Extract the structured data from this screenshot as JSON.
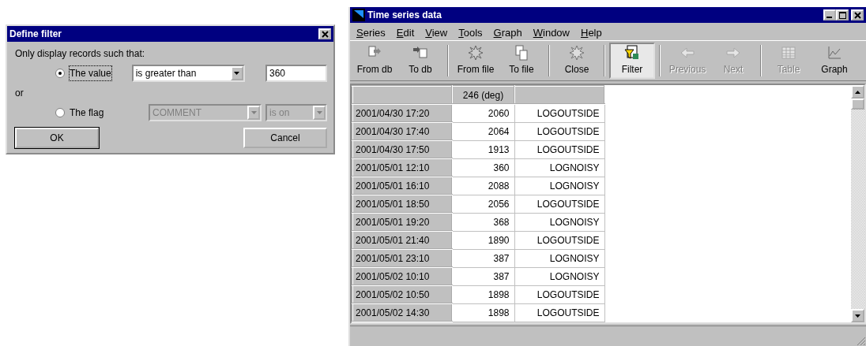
{
  "filter_dialog": {
    "title": "Define filter",
    "prompt": "Only display records such that:",
    "conjunction": "or",
    "options": [
      {
        "label": "The value",
        "selected": true,
        "condition": {
          "value": "is greater than",
          "disabled": false
        },
        "operand": {
          "kind": "text",
          "value": "360",
          "disabled": false
        }
      },
      {
        "label": "The flag",
        "selected": false,
        "condition": {
          "value": "COMMENT",
          "disabled": true
        },
        "operand": {
          "kind": "combo",
          "value": "is on",
          "disabled": true
        }
      }
    ],
    "buttons": [
      "OK",
      "Cancel"
    ]
  },
  "window": {
    "title": "Time series data",
    "menu": [
      "Series",
      "Edit",
      "View",
      "Tools",
      "Graph",
      "Window",
      "Help"
    ],
    "toolbar": [
      {
        "label": "From db",
        "kind": "from-db",
        "disabled": false,
        "selected": false,
        "separator_before": false
      },
      {
        "label": "To db",
        "kind": "to-db",
        "disabled": false,
        "selected": false,
        "separator_before": false
      },
      {
        "label": "From file",
        "kind": "from-file",
        "disabled": false,
        "selected": false,
        "separator_before": true
      },
      {
        "label": "To file",
        "kind": "to-file",
        "disabled": false,
        "selected": false,
        "separator_before": false
      },
      {
        "label": "Close",
        "kind": "close",
        "disabled": false,
        "selected": false,
        "separator_before": true
      },
      {
        "label": "Filter",
        "kind": "filter",
        "disabled": false,
        "selected": true,
        "separator_before": true
      },
      {
        "label": "Previous",
        "kind": "previous",
        "disabled": true,
        "selected": false,
        "separator_before": true
      },
      {
        "label": "Next",
        "kind": "next",
        "disabled": true,
        "selected": false,
        "separator_before": false
      },
      {
        "label": "Table",
        "kind": "table",
        "disabled": true,
        "selected": false,
        "separator_before": true
      },
      {
        "label": "Graph",
        "kind": "graph",
        "disabled": false,
        "selected": false,
        "separator_before": false
      }
    ],
    "table": {
      "columns": [
        "246 (deg)"
      ],
      "rows": [
        {
          "time": "2001/04/30 17:20",
          "value": "2060",
          "flag": "LOGOUTSIDE"
        },
        {
          "time": "2001/04/30 17:40",
          "value": "2064",
          "flag": "LOGOUTSIDE"
        },
        {
          "time": "2001/04/30 17:50",
          "value": "1913",
          "flag": "LOGOUTSIDE"
        },
        {
          "time": "2001/05/01 12:10",
          "value": "360",
          "flag": "LOGNOISY"
        },
        {
          "time": "2001/05/01 16:10",
          "value": "2088",
          "flag": "LOGNOISY"
        },
        {
          "time": "2001/05/01 18:50",
          "value": "2056",
          "flag": "LOGOUTSIDE"
        },
        {
          "time": "2001/05/01 19:20",
          "value": "368",
          "flag": "LOGNOISY"
        },
        {
          "time": "2001/05/01 21:40",
          "value": "1890",
          "flag": "LOGOUTSIDE"
        },
        {
          "time": "2001/05/01 23:10",
          "value": "387",
          "flag": "LOGNOISY"
        },
        {
          "time": "2001/05/02 10:10",
          "value": "387",
          "flag": "LOGNOISY"
        },
        {
          "time": "2001/05/02 10:50",
          "value": "1898",
          "flag": "LOGOUTSIDE"
        },
        {
          "time": "2001/05/02 14:30",
          "value": "1898",
          "flag": "LOGOUTSIDE"
        }
      ]
    }
  }
}
